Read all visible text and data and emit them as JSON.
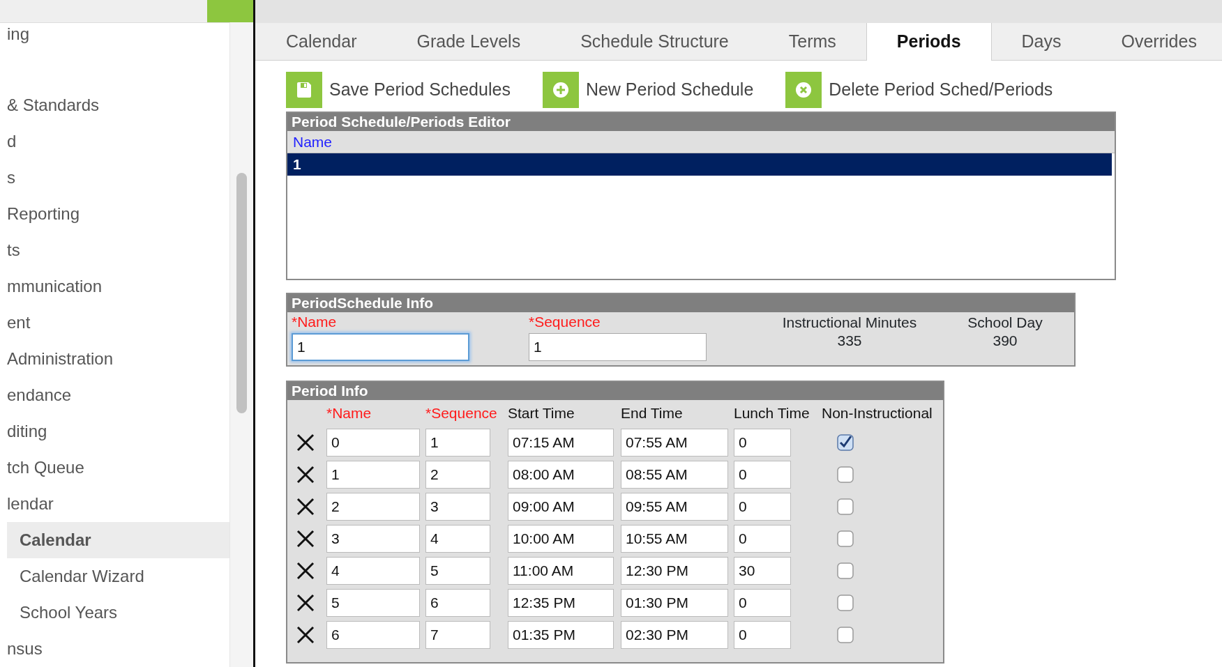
{
  "sidebar": {
    "items": [
      {
        "label": "ing",
        "selected": false
      },
      {
        "label": "& Standards",
        "selected": false
      },
      {
        "label": "d",
        "selected": false
      },
      {
        "label": "s",
        "selected": false
      },
      {
        "label": "Reporting",
        "selected": false
      },
      {
        "label": "ts",
        "selected": false
      },
      {
        "label": "mmunication",
        "selected": false
      },
      {
        "label": "ent",
        "selected": false
      },
      {
        "label": "Administration",
        "selected": false
      },
      {
        "label": "endance",
        "selected": false
      },
      {
        "label": "diting",
        "selected": false
      },
      {
        "label": "tch Queue",
        "selected": false
      },
      {
        "label": "lendar",
        "selected": false,
        "children": [
          {
            "label": "Calendar",
            "selected": true
          },
          {
            "label": "Calendar Wizard",
            "selected": false
          },
          {
            "label": "School Years",
            "selected": false
          }
        ]
      },
      {
        "label": "nsus",
        "selected": false
      }
    ]
  },
  "tabs": [
    {
      "label": "Calendar",
      "selected": false
    },
    {
      "label": "Grade Levels",
      "selected": false
    },
    {
      "label": "Schedule Structure",
      "selected": false
    },
    {
      "label": "Terms",
      "selected": false
    },
    {
      "label": "Periods",
      "selected": true
    },
    {
      "label": "Days",
      "selected": false
    },
    {
      "label": "Overrides",
      "selected": false
    }
  ],
  "toolbar": [
    {
      "kind": "save",
      "label": "Save Period Schedules"
    },
    {
      "kind": "new",
      "label": "New Period Schedule"
    },
    {
      "kind": "delete",
      "label": "Delete Period Sched/Periods"
    }
  ],
  "editor": {
    "title": "Period Schedule/Periods Editor",
    "column": "Name",
    "rows": [
      {
        "name": "1",
        "selected": true
      }
    ]
  },
  "schedule_info": {
    "title": "PeriodSchedule Info",
    "name": {
      "label": "*Name",
      "required": true,
      "value": "1",
      "focused": true
    },
    "sequence": {
      "label": "*Sequence",
      "required": true,
      "value": "1",
      "focused": false
    },
    "instructional_minutes": {
      "label": "Instructional Minutes",
      "value": "335"
    },
    "school_day": {
      "label": "School Day",
      "value": "390"
    }
  },
  "period_info": {
    "title": "Period Info",
    "columns": [
      {
        "label": "*Name",
        "required": true
      },
      {
        "label": "*Sequence",
        "required": true
      },
      {
        "label": "Start Time",
        "required": false
      },
      {
        "label": "End Time",
        "required": false
      },
      {
        "label": "Lunch Time",
        "required": false
      },
      {
        "label": "Non-Instructional",
        "required": false
      }
    ],
    "rows": [
      {
        "name": "0",
        "sequence": "1",
        "start": "07:15 AM",
        "end": "07:55 AM",
        "lunch": "0",
        "non_instructional": true
      },
      {
        "name": "1",
        "sequence": "2",
        "start": "08:00 AM",
        "end": "08:55 AM",
        "lunch": "0",
        "non_instructional": false
      },
      {
        "name": "2",
        "sequence": "3",
        "start": "09:00 AM",
        "end": "09:55 AM",
        "lunch": "0",
        "non_instructional": false
      },
      {
        "name": "3",
        "sequence": "4",
        "start": "10:00 AM",
        "end": "10:55 AM",
        "lunch": "0",
        "non_instructional": false
      },
      {
        "name": "4",
        "sequence": "5",
        "start": "11:00 AM",
        "end": "12:30 PM",
        "lunch": "30",
        "non_instructional": false
      },
      {
        "name": "5",
        "sequence": "6",
        "start": "12:35 PM",
        "end": "01:30 PM",
        "lunch": "0",
        "non_instructional": false
      },
      {
        "name": "6",
        "sequence": "7",
        "start": "01:35 PM",
        "end": "02:30 PM",
        "lunch": "0",
        "non_instructional": false
      }
    ]
  }
}
